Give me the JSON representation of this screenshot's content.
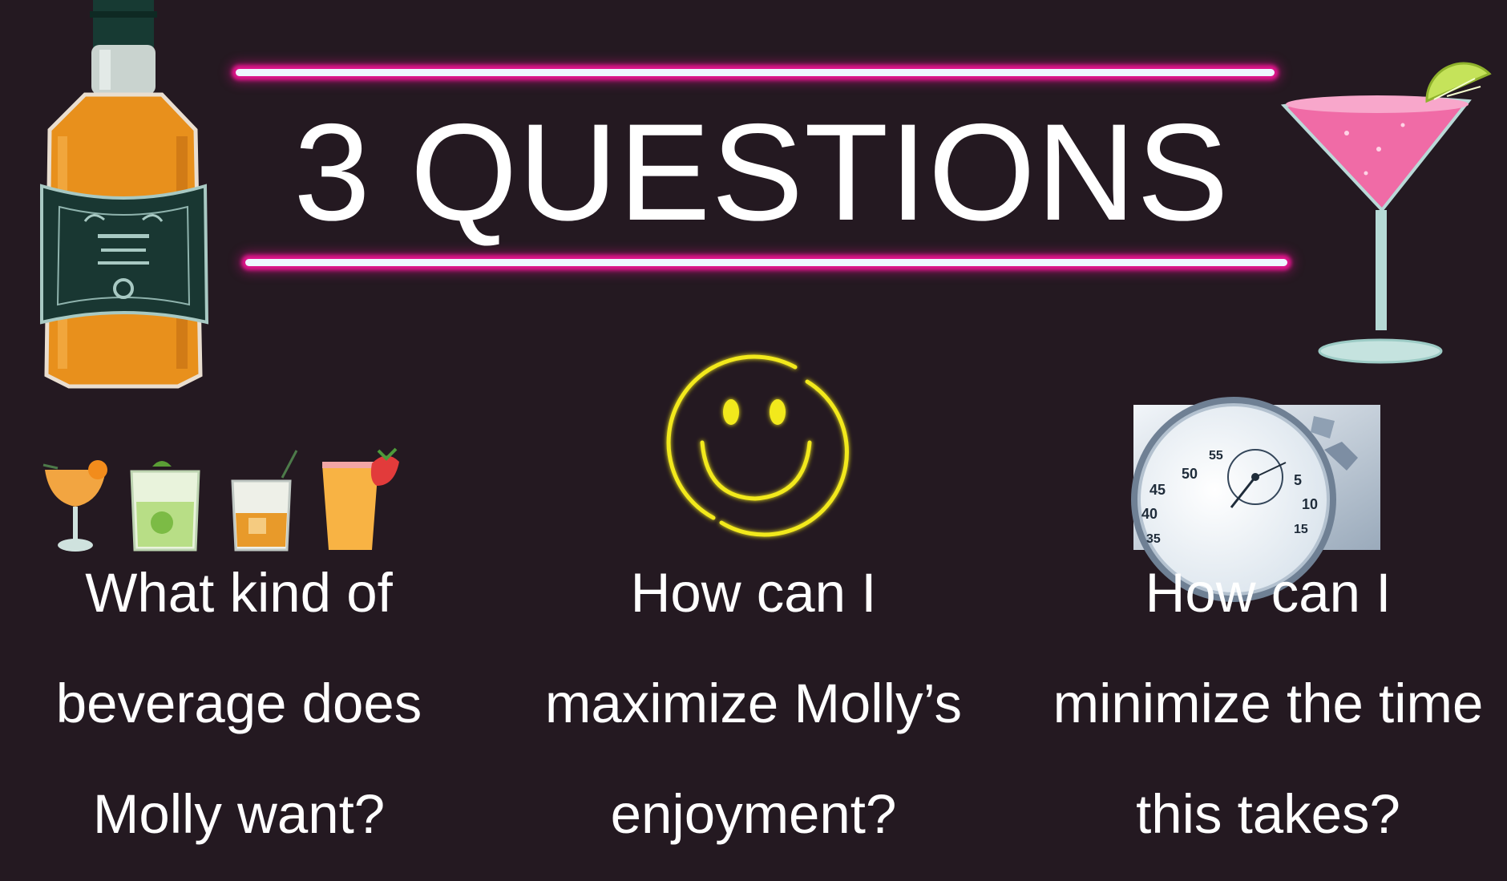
{
  "slide": {
    "title": "3 QUESTIONS",
    "background_color": "#241921",
    "neon_color": "#e0158c"
  },
  "questions": [
    {
      "lines": [
        "What kind of",
        "beverage does",
        "Molly want?"
      ],
      "icon": "cocktail-glasses-icon"
    },
    {
      "lines": [
        "How can I",
        "maximize Molly’s",
        "enjoyment?"
      ],
      "icon": "neon-smiley-icon"
    },
    {
      "lines": [
        "How can I",
        "minimize the time",
        "this takes?"
      ],
      "icon": "stopwatch-image"
    }
  ],
  "stopwatch": {
    "dial_numbers": [
      "50",
      "55",
      "5",
      "10",
      "15",
      "45",
      "40",
      "35"
    ]
  },
  "decorations": [
    "whiskey-bottle-illustration",
    "pink-martini-illustration"
  ]
}
